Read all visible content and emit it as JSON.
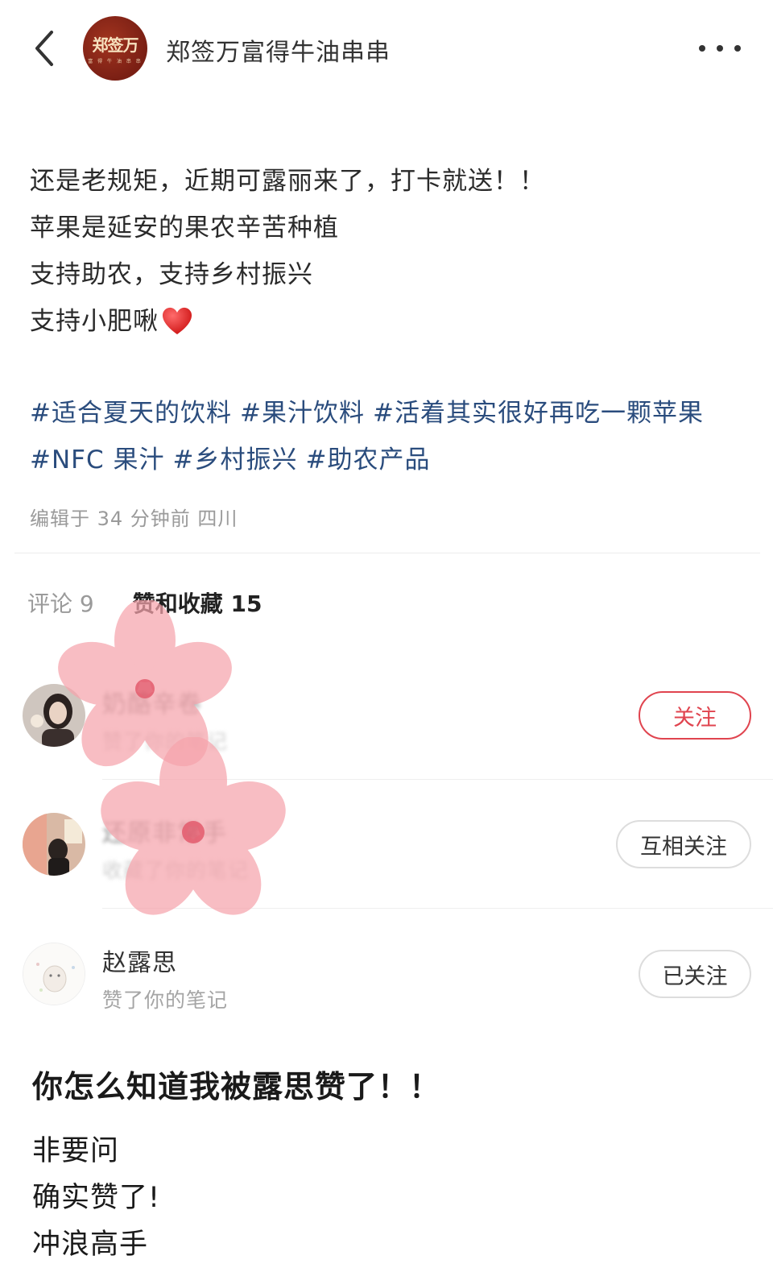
{
  "header": {
    "shop_name": "郑签万富得牛油串串",
    "logo_text": "郑签万",
    "logo_sub": "富 得 牛 油 串 串",
    "back_icon": "chevron-left-icon",
    "more_icon": "more-dots-icon"
  },
  "post": {
    "lines": [
      "还是老规矩，近期可露丽来了，打卡就送！！",
      "苹果是延安的果农辛苦种植",
      "支持助农，支持乡村振兴",
      "支持小肥啾"
    ],
    "heart_icon": "red-heart-icon",
    "tags": [
      "#适合夏天的饮料",
      "#果汁饮料",
      "#活着其实很好再吃一颗苹果",
      "#NFC 果汁",
      "#乡村振兴",
      "#助农产品"
    ],
    "meta": "编辑于 34 分钟前 四川"
  },
  "tabs": {
    "comments": "评论 9",
    "likes": "赞和收藏 15"
  },
  "users": [
    {
      "name": "奶酪辛卷",
      "action": "赞了你的笔记",
      "button": "关注"
    },
    {
      "name": "还原非常手",
      "action": "收藏了你的笔记",
      "button": "互相关注"
    },
    {
      "name": "赵露思",
      "action": "赞了你的笔记",
      "button": "已关注"
    }
  ],
  "bottom": {
    "title": "你怎么知道我被露思赞了！！",
    "lines": [
      "非要问",
      "确实赞了!",
      "冲浪高手"
    ]
  },
  "colors": {
    "tag": "#2a4c7d",
    "follow": "#e0444f",
    "logo_bg": "#8b2517"
  }
}
